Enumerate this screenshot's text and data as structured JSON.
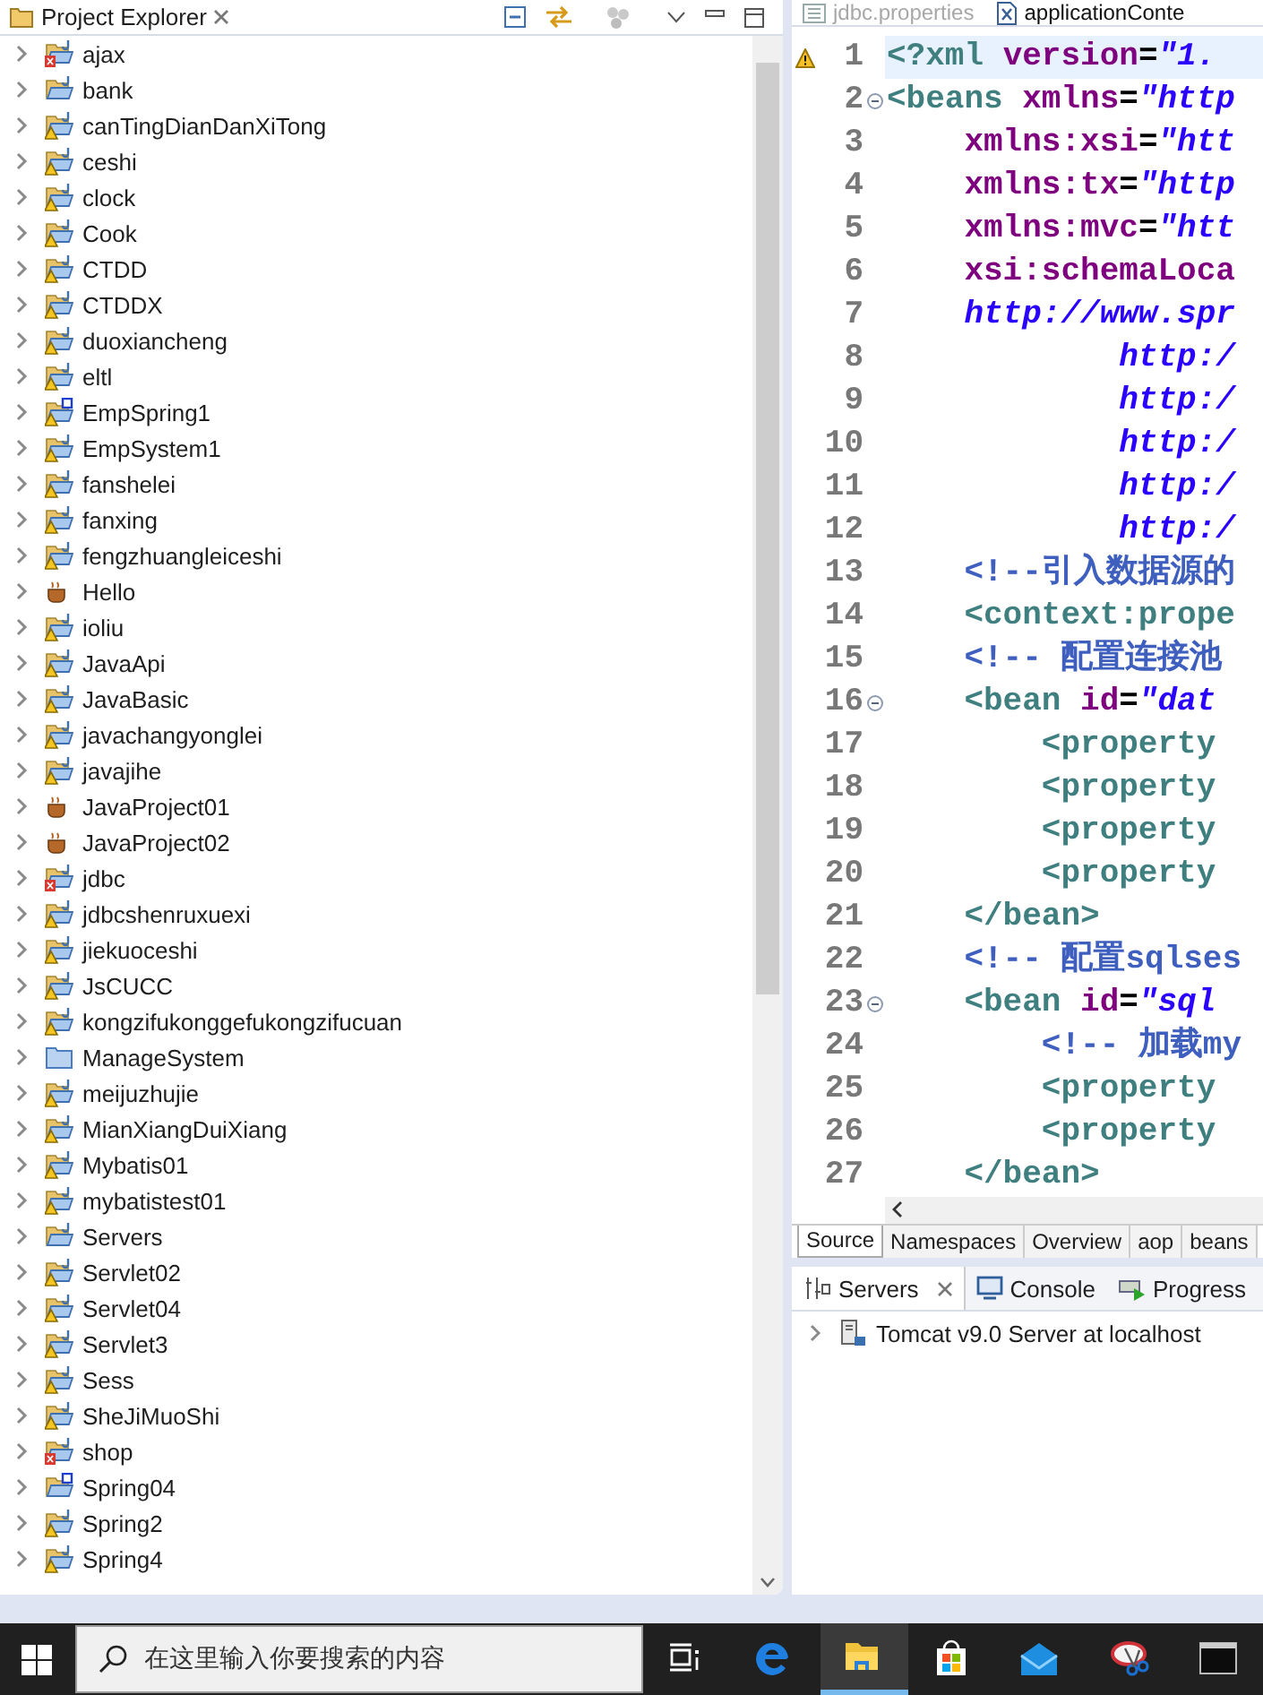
{
  "explorer": {
    "title": "Project Explorer",
    "projects": [
      {
        "name": "ajax",
        "kind": "error"
      },
      {
        "name": "bank",
        "kind": "plain"
      },
      {
        "name": "canTingDianDanXiTong",
        "kind": "warn"
      },
      {
        "name": "ceshi",
        "kind": "warn"
      },
      {
        "name": "clock",
        "kind": "warn"
      },
      {
        "name": "Cook",
        "kind": "warn"
      },
      {
        "name": "CTDD",
        "kind": "warn"
      },
      {
        "name": "CTDDX",
        "kind": "warn"
      },
      {
        "name": "duoxiancheng",
        "kind": "warn"
      },
      {
        "name": "eltl",
        "kind": "warn"
      },
      {
        "name": "EmpSpring1",
        "kind": "spring-warn"
      },
      {
        "name": "EmpSystem1",
        "kind": "warn"
      },
      {
        "name": "fanshelei",
        "kind": "warn"
      },
      {
        "name": "fanxing",
        "kind": "warn"
      },
      {
        "name": "fengzhuangleiceshi",
        "kind": "warn"
      },
      {
        "name": "Hello",
        "kind": "java"
      },
      {
        "name": "ioliu",
        "kind": "warn"
      },
      {
        "name": "JavaApi",
        "kind": "warn"
      },
      {
        "name": "JavaBasic",
        "kind": "warn"
      },
      {
        "name": "javachangyonglei",
        "kind": "warn"
      },
      {
        "name": "javajihe",
        "kind": "warn"
      },
      {
        "name": "JavaProject01",
        "kind": "java"
      },
      {
        "name": "JavaProject02",
        "kind": "java"
      },
      {
        "name": "jdbc",
        "kind": "error"
      },
      {
        "name": "jdbcshenruxuexi",
        "kind": "warn"
      },
      {
        "name": "jiekuoceshi",
        "kind": "warn"
      },
      {
        "name": "JsCUCC",
        "kind": "warn"
      },
      {
        "name": "kongzifukonggefukongzifucuan",
        "kind": "warn"
      },
      {
        "name": "ManageSystem",
        "kind": "folder"
      },
      {
        "name": "meijuzhujie",
        "kind": "warn"
      },
      {
        "name": "MianXiangDuiXiang",
        "kind": "warn"
      },
      {
        "name": "Mybatis01",
        "kind": "warn"
      },
      {
        "name": "mybatistest01",
        "kind": "warn"
      },
      {
        "name": "Servers",
        "kind": "plain"
      },
      {
        "name": "Servlet02",
        "kind": "warn"
      },
      {
        "name": "Servlet04",
        "kind": "warn"
      },
      {
        "name": "Servlet3",
        "kind": "warn"
      },
      {
        "name": "Sess",
        "kind": "warn"
      },
      {
        "name": "SheJiMuoShi",
        "kind": "warn"
      },
      {
        "name": "shop",
        "kind": "error"
      },
      {
        "name": "Spring04",
        "kind": "spring"
      },
      {
        "name": "Spring2",
        "kind": "warn"
      },
      {
        "name": "Spring4",
        "kind": "warn"
      }
    ]
  },
  "editor": {
    "tabs": [
      {
        "label": "jdbc.properties",
        "selected": false
      },
      {
        "label": "applicationConte",
        "selected": true
      }
    ],
    "lines": [
      {
        "number": "1",
        "current": true,
        "warning": true,
        "foldable": false,
        "tokens": [
          {
            "kind": "tag",
            "text": "<?xml"
          },
          {
            "kind": "attr",
            "text": " version"
          },
          {
            "kind": "eq",
            "text": "="
          },
          {
            "kind": "value",
            "text": "\"1."
          }
        ]
      },
      {
        "number": "2",
        "current": false,
        "warning": false,
        "foldable": true,
        "tokens": [
          {
            "kind": "tag",
            "text": "<beans"
          },
          {
            "kind": "attr",
            "text": " xmlns"
          },
          {
            "kind": "eq",
            "text": "="
          },
          {
            "kind": "value",
            "text": "\"http"
          }
        ]
      },
      {
        "number": "3",
        "current": false,
        "warning": false,
        "foldable": false,
        "tokens": [
          {
            "kind": "attr",
            "text": "    xmlns:xsi"
          },
          {
            "kind": "eq",
            "text": "="
          },
          {
            "kind": "value",
            "text": "\"htt"
          }
        ]
      },
      {
        "number": "4",
        "current": false,
        "warning": false,
        "foldable": false,
        "tokens": [
          {
            "kind": "attr",
            "text": "    xmlns:tx"
          },
          {
            "kind": "eq",
            "text": "="
          },
          {
            "kind": "value",
            "text": "\"http"
          }
        ]
      },
      {
        "number": "5",
        "current": false,
        "warning": false,
        "foldable": false,
        "tokens": [
          {
            "kind": "attr",
            "text": "    xmlns:mvc"
          },
          {
            "kind": "eq",
            "text": "="
          },
          {
            "kind": "value",
            "text": "\"htt"
          }
        ]
      },
      {
        "number": "6",
        "current": false,
        "warning": false,
        "foldable": false,
        "tokens": [
          {
            "kind": "attr",
            "text": "    xsi:schemaLoca"
          }
        ]
      },
      {
        "number": "7",
        "current": false,
        "warning": false,
        "foldable": false,
        "tokens": [
          {
            "kind": "value",
            "text": "    http://www.spr"
          }
        ]
      },
      {
        "number": "8",
        "current": false,
        "warning": false,
        "foldable": false,
        "tokens": [
          {
            "kind": "value",
            "text": "            http:/"
          }
        ]
      },
      {
        "number": "9",
        "current": false,
        "warning": false,
        "foldable": false,
        "tokens": [
          {
            "kind": "value",
            "text": "            http:/"
          }
        ]
      },
      {
        "number": "10",
        "current": false,
        "warning": false,
        "foldable": false,
        "tokens": [
          {
            "kind": "value",
            "text": "            http:/"
          }
        ]
      },
      {
        "number": "11",
        "current": false,
        "warning": false,
        "foldable": false,
        "tokens": [
          {
            "kind": "value",
            "text": "            http:/"
          }
        ]
      },
      {
        "number": "12",
        "current": false,
        "warning": false,
        "foldable": false,
        "tokens": [
          {
            "kind": "value",
            "text": "            http:/"
          }
        ]
      },
      {
        "number": "13",
        "current": false,
        "warning": false,
        "foldable": false,
        "tokens": [
          {
            "kind": "comment",
            "text": "    <!--引入数据源的"
          }
        ]
      },
      {
        "number": "14",
        "current": false,
        "warning": false,
        "foldable": false,
        "tokens": [
          {
            "kind": "tag",
            "text": "    <context:prope"
          }
        ]
      },
      {
        "number": "15",
        "current": false,
        "warning": false,
        "foldable": false,
        "tokens": [
          {
            "kind": "comment",
            "text": "    <!-- 配置连接池"
          }
        ]
      },
      {
        "number": "16",
        "current": false,
        "warning": false,
        "foldable": true,
        "tokens": [
          {
            "kind": "tag",
            "text": "    <bean"
          },
          {
            "kind": "attr",
            "text": " id"
          },
          {
            "kind": "eq",
            "text": "="
          },
          {
            "kind": "value",
            "text": "\"dat"
          }
        ]
      },
      {
        "number": "17",
        "current": false,
        "warning": false,
        "foldable": false,
        "tokens": [
          {
            "kind": "tag",
            "text": "        <property"
          }
        ]
      },
      {
        "number": "18",
        "current": false,
        "warning": false,
        "foldable": false,
        "tokens": [
          {
            "kind": "tag",
            "text": "        <property"
          }
        ]
      },
      {
        "number": "19",
        "current": false,
        "warning": false,
        "foldable": false,
        "tokens": [
          {
            "kind": "tag",
            "text": "        <property"
          }
        ]
      },
      {
        "number": "20",
        "current": false,
        "warning": false,
        "foldable": false,
        "tokens": [
          {
            "kind": "tag",
            "text": "        <property"
          }
        ]
      },
      {
        "number": "21",
        "current": false,
        "warning": false,
        "foldable": false,
        "tokens": [
          {
            "kind": "tag",
            "text": "    </bean>"
          }
        ]
      },
      {
        "number": "22",
        "current": false,
        "warning": false,
        "foldable": false,
        "tokens": [
          {
            "kind": "comment",
            "text": "    <!-- 配置sqlses"
          }
        ]
      },
      {
        "number": "23",
        "current": false,
        "warning": false,
        "foldable": true,
        "tokens": [
          {
            "kind": "tag",
            "text": "    <bean"
          },
          {
            "kind": "attr",
            "text": " id"
          },
          {
            "kind": "eq",
            "text": "="
          },
          {
            "kind": "value",
            "text": "\"sql"
          }
        ]
      },
      {
        "number": "24",
        "current": false,
        "warning": false,
        "foldable": false,
        "tokens": [
          {
            "kind": "comment",
            "text": "        <!-- 加载my"
          }
        ]
      },
      {
        "number": "25",
        "current": false,
        "warning": false,
        "foldable": false,
        "tokens": [
          {
            "kind": "tag",
            "text": "        <property"
          }
        ]
      },
      {
        "number": "26",
        "current": false,
        "warning": false,
        "foldable": false,
        "tokens": [
          {
            "kind": "tag",
            "text": "        <property"
          }
        ]
      },
      {
        "number": "27",
        "current": false,
        "warning": false,
        "foldable": false,
        "tokens": [
          {
            "kind": "tag",
            "text": "    </bean>"
          }
        ]
      }
    ],
    "bottom_tabs": [
      {
        "label": "Source",
        "selected": true
      },
      {
        "label": "Namespaces",
        "selected": false
      },
      {
        "label": "Overview",
        "selected": false
      },
      {
        "label": "aop",
        "selected": false
      },
      {
        "label": "beans",
        "selected": false
      }
    ]
  },
  "servers_panel": {
    "tabs": [
      {
        "label": "Servers",
        "kind": "servers",
        "selected": true
      },
      {
        "label": "Console",
        "kind": "console",
        "selected": false
      },
      {
        "label": "Progress",
        "kind": "progress",
        "selected": false
      }
    ],
    "servers": [
      {
        "name": "Tomcat v9.0 Server at localhost"
      }
    ]
  },
  "taskbar": {
    "search": {
      "placeholder": "在这里输入你要搜索的内容"
    },
    "apps": [
      {
        "kind": "task-view",
        "selected": false
      },
      {
        "kind": "browser",
        "selected": false
      },
      {
        "kind": "file-explorer",
        "selected": true
      },
      {
        "kind": "store",
        "selected": false
      },
      {
        "kind": "mail",
        "selected": false
      },
      {
        "kind": "snipping",
        "selected": false
      },
      {
        "kind": "terminal",
        "selected": false
      }
    ]
  }
}
